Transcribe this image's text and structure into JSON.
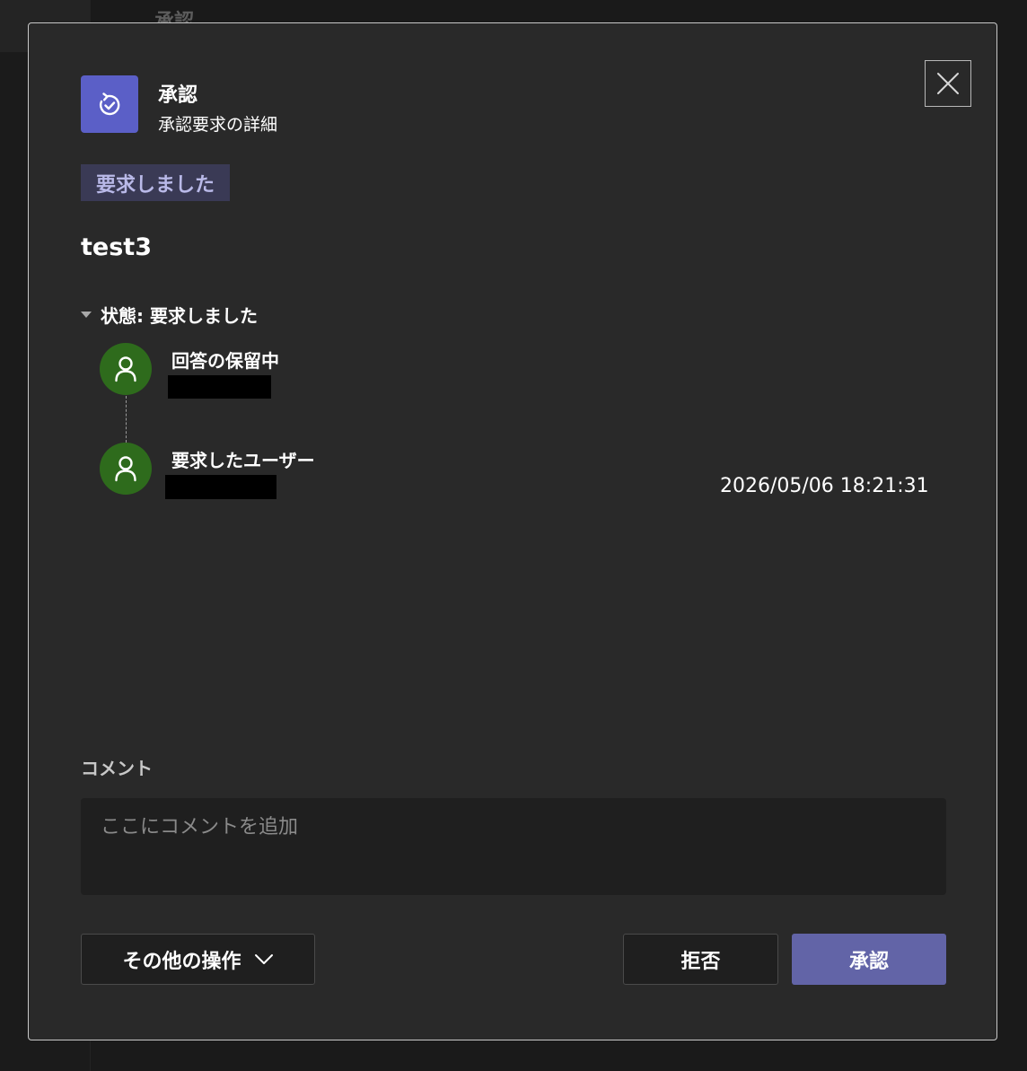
{
  "background": {
    "title": "承認"
  },
  "header": {
    "app_name": "承認",
    "subtitle": "承認要求の詳細",
    "app_icon": "approvals-icon",
    "close_icon": "close-icon"
  },
  "status_badge": "要求しました",
  "request_title": "test3",
  "state": {
    "label": "状態: 要求しました",
    "steps": [
      {
        "label": "回答の保留中",
        "icon": "person-icon"
      },
      {
        "label": "要求したユーザー",
        "icon": "person-icon",
        "timestamp": "2026/05/06 18:21:31"
      }
    ]
  },
  "comment": {
    "label": "コメント",
    "placeholder": "ここにコメントを追加",
    "value": ""
  },
  "actions": {
    "more_label": "その他の操作",
    "reject_label": "拒否",
    "approve_label": "承認"
  },
  "colors": {
    "accent": "#6264a7",
    "app_icon_bg": "#5b5fc7",
    "avatar_bg": "#2e6b1c",
    "badge_bg": "#3a3a55",
    "badge_text": "#b9b9e8"
  }
}
